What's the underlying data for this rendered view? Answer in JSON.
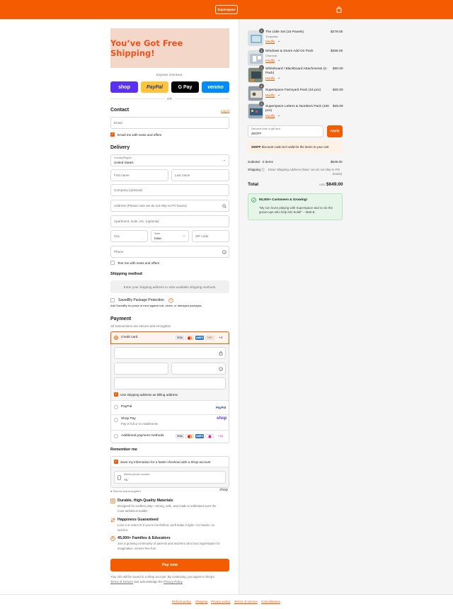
{
  "brand": {
    "name": "Superspace",
    "accent": "#f55b00"
  },
  "header": {
    "logo": "Superspace",
    "cart_icon": "bag-icon"
  },
  "banner": {
    "text": "You’ve Got Free Shipping!"
  },
  "express": {
    "label": "Express checkout",
    "or": "OR",
    "buttons": [
      "shop",
      "PayPal",
      "G Pay",
      "venmo"
    ]
  },
  "contact": {
    "title": "Contact",
    "login": "Log in",
    "email_placeholder": "Email",
    "news": "Email me with news and offers"
  },
  "delivery": {
    "title": "Delivery",
    "country_label": "Country/Region",
    "country_value": "United States",
    "first": "First name",
    "last": "Last name",
    "company": "Company (optional)",
    "address": "Address (Please note we do not ship to PO boxes)",
    "apt": "Apartment, suite, etc. (optional)",
    "city": "City",
    "state_label": "State",
    "state_value": "Iowa",
    "zip": "ZIP code",
    "phone": "Phone",
    "text_me": "Text me with news and offers"
  },
  "shipping": {
    "title": "Shipping method",
    "note": "Enter your shipping address to view available shipping methods.",
    "savedby": "SavedBy Package Protection",
    "savedby_note": "Add SavedBy for peace of mind against lost, stolen, or damaged packages"
  },
  "payment": {
    "title": "Payment",
    "sub": "All transactions are secure and encrypted.",
    "credit": "Credit card",
    "card_brands": [
      "VISA",
      "MC",
      "AMEX",
      "DISC"
    ],
    "more": "+4",
    "billing": "Use shipping address as billing address",
    "paypal": "PayPal",
    "paypal_logo": "PayPal",
    "shoppay": "Shop Pay",
    "shoppay_sub": "Pay in full or in installments",
    "shoppay_logo": "shop",
    "additional": "Additional payment methods",
    "additional_more": "+11"
  },
  "remember": {
    "title": "Remember me",
    "save": "Save my information for a faster checkout with a Shop account",
    "mobile_label": "Mobile phone number",
    "mobile_value": "+1",
    "secure": "Secure and encrypted",
    "shop": "shop"
  },
  "features": [
    {
      "title": "Durable, High-Quality Materials",
      "desc1": "Designed for endless play—strong, safe, and made to withstand even the",
      "desc2": "most ambitious builds!"
    },
    {
      "title": "Happiness Guaranteed",
      "desc1": "Love it or return it! If you're not thrilled, we'll make it right—no hassle, no",
      "desc2": "worries."
    },
    {
      "title": "45,000+ Families & Educators",
      "desc1": "Join a growing community of parents and teachers who trust Superspace for",
      "desc2": "imaginative, screen-free fun!"
    }
  ],
  "pay": {
    "button": "Pay now",
    "fine1": "Your info will be saved to a Shop account. By continuing, you agree to Shop’s",
    "terms": "Terms of Service",
    "and": "and acknowledge the",
    "privacy": "Privacy Policy"
  },
  "footer": {
    "links": [
      "Refund policy",
      "Shipping",
      "Privacy policy",
      "Terms of service",
      "Cancellations"
    ]
  },
  "cart": {
    "items": [
      {
        "name": "The Little Set (16 Panels)",
        "variant": "Turquoise",
        "price": "$279.00",
        "qty": "1",
        "modify": "Modify"
      },
      {
        "name": "Windows & Doors Add On Pack",
        "variant": "Charcoal",
        "price": "$255.00",
        "qty": "1",
        "modify": "Modify"
      },
      {
        "name": "Whiteboard / Blackboard Attachments (2-",
        "name2": "Pack)",
        "variant": "",
        "price": "$30.00",
        "qty": "1",
        "modify": "Modify"
      },
      {
        "name": "Superspace Farmyard Pack (16 pcs)",
        "variant": "",
        "price": "$40.00",
        "qty": "1",
        "modify": "Modify"
      },
      {
        "name": "Superspace Letters & Numbers Pack (106",
        "name2": "pcs)",
        "variant": "",
        "price": "$45.00",
        "qty": "1",
        "modify": "Modify"
      }
    ],
    "discount_label": "Discount code or gift card",
    "discount_value": "25OFF",
    "apply": "Apply",
    "discount_msg_code": "25OFF",
    "discount_msg": "discount code isn't valid for the items in your cart",
    "subtotal_label": "Subtotal · 5 items",
    "subtotal": "$649.00",
    "shipping_label": "Shipping",
    "shipping_value": "Enter Shipping Address (Note: we do not ship to PO",
    "shipping_value2": "boxes)",
    "total_label": "Total",
    "currency": "USD",
    "total": "$649.00",
    "review_title": "50,000+ Customers & Growing!",
    "review_text1": "\"My son loves playing with Superspace-and so do the",
    "review_text2": "grown-ups who help him build!\" – Matt B."
  }
}
